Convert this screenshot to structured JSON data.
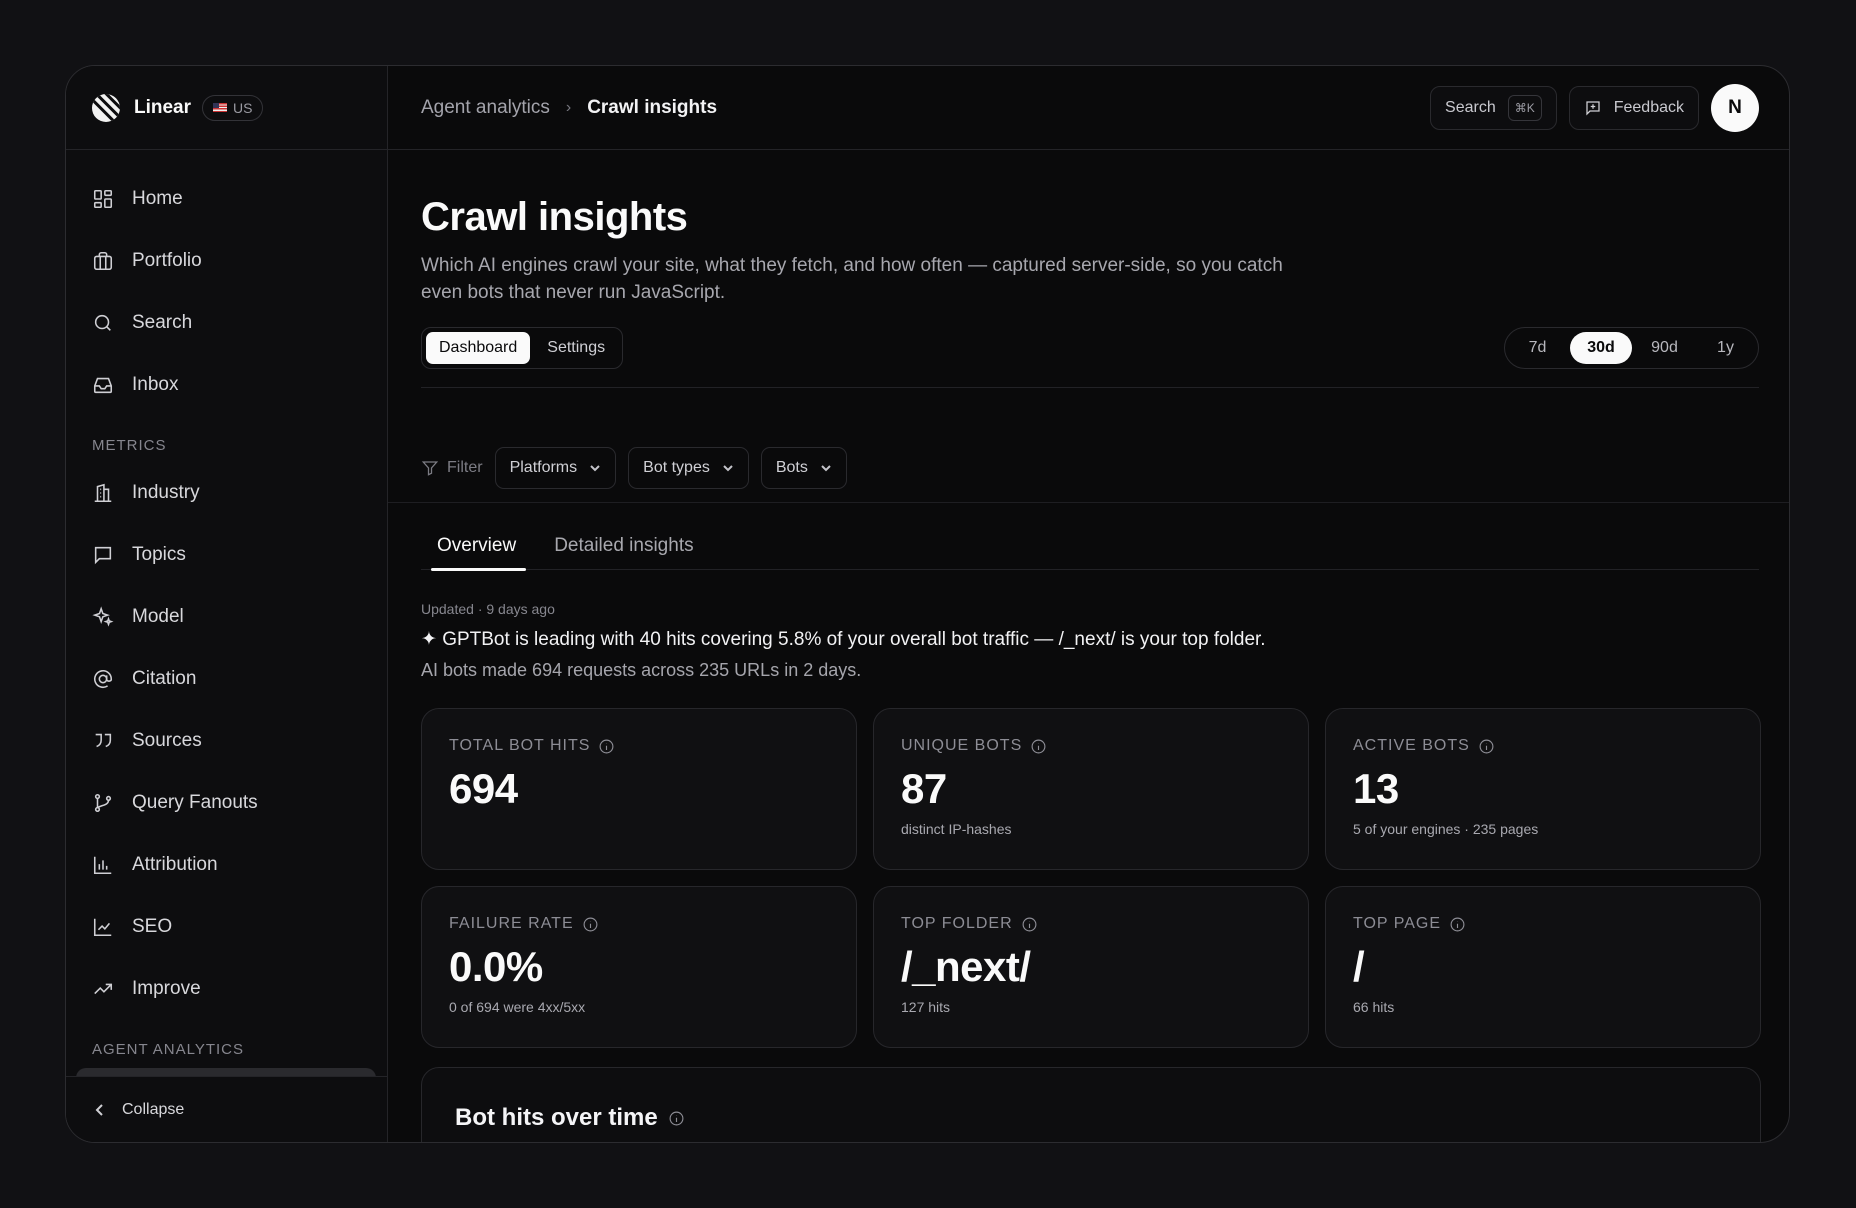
{
  "brand": {
    "name": "Linear",
    "region": "US"
  },
  "sidebar": {
    "items": [
      {
        "label": "Home",
        "icon": "grid-icon"
      },
      {
        "label": "Portfolio",
        "icon": "briefcase-icon"
      },
      {
        "label": "Search",
        "icon": "search-icon"
      },
      {
        "label": "Inbox",
        "icon": "inbox-icon"
      }
    ],
    "metrics_heading": "METRICS",
    "metrics": [
      {
        "label": "Industry",
        "icon": "building-icon"
      },
      {
        "label": "Topics",
        "icon": "message-square-icon"
      },
      {
        "label": "Model",
        "icon": "sparkles-icon"
      },
      {
        "label": "Citation",
        "icon": "at-sign-icon"
      },
      {
        "label": "Sources",
        "icon": "quote-icon"
      },
      {
        "label": "Query Fanouts",
        "icon": "git-branch-icon"
      },
      {
        "label": "Attribution",
        "icon": "bar-chart-icon"
      },
      {
        "label": "SEO",
        "icon": "line-chart-icon"
      },
      {
        "label": "Improve",
        "icon": "trending-up-icon"
      }
    ],
    "agent_heading": "AGENT ANALYTICS",
    "collapse_label": "Collapse"
  },
  "topbar": {
    "breadcrumb_parent": "Agent analytics",
    "breadcrumb_current": "Crawl insights",
    "search_label": "Search",
    "search_shortcut": "⌘K",
    "feedback_label": "Feedback",
    "avatar_initial": "N"
  },
  "page": {
    "title": "Crawl insights",
    "description": "Which AI engines crawl your site, what they fetch, and how often — captured server-side, so you catch even bots that never run JavaScript.",
    "view_tabs": [
      "Dashboard",
      "Settings"
    ],
    "ranges": [
      "7d",
      "30d",
      "90d",
      "1y"
    ],
    "selected_range": "30d"
  },
  "filters": {
    "label": "Filter",
    "dropdowns": [
      "Platforms",
      "Bot types",
      "Bots"
    ]
  },
  "tabs": [
    "Overview",
    "Detailed insights"
  ],
  "overview": {
    "updated": "Updated · 9 days ago",
    "headline": "✦ GPTBot is leading with 40 hits covering 5.8% of your overall bot traffic — /_next/ is your top folder.",
    "summary": "AI bots made 694 requests across 235 URLs in 2 days."
  },
  "cards": [
    {
      "label": "TOTAL BOT HITS",
      "value": "694",
      "sub": ""
    },
    {
      "label": "UNIQUE BOTS",
      "value": "87",
      "sub": "distinct IP-hashes"
    },
    {
      "label": "ACTIVE BOTS",
      "value": "13",
      "sub": "5 of your engines · 235 pages"
    },
    {
      "label": "FAILURE RATE",
      "value": "0.0%",
      "sub": "0 of 694 were 4xx/5xx"
    },
    {
      "label": "TOP FOLDER",
      "value": "/_next/",
      "sub": "127 hits"
    },
    {
      "label": "TOP PAGE",
      "value": "/",
      "sub": "66 hits"
    }
  ],
  "chart_section": {
    "title": "Bot hits over time"
  }
}
